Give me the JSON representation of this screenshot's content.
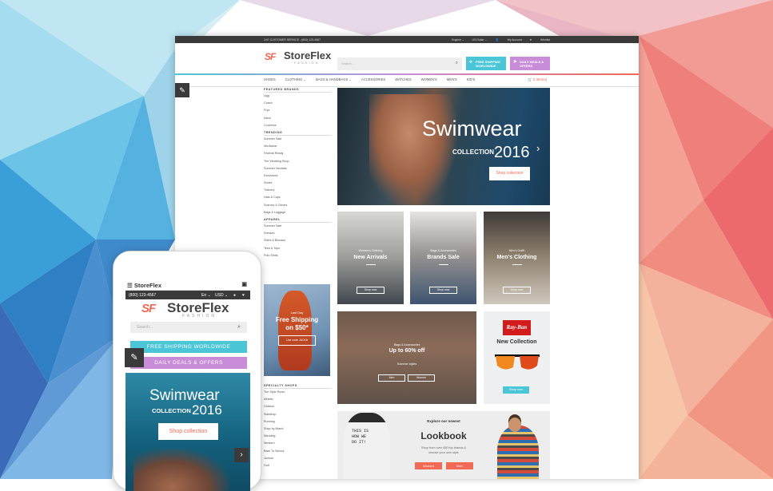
{
  "desktop": {
    "topbar": {
      "service": "24/7 CUSTOMER SERVICE - (800) 123-4567",
      "language": "English ⌄",
      "currency": "US Dollar ⌄",
      "account": "My Account",
      "wishlist": "Wishlist"
    },
    "logo": {
      "mark": "SF",
      "name": "StoreFlex",
      "sub": "FASHION"
    },
    "search": {
      "placeholder": "Search..."
    },
    "promos": {
      "free_shipping": "FREE SHIPPING WORLDWIDE",
      "deals": "DAILY DEALS & OFFERS"
    },
    "nav": [
      "SHOES",
      "CLOTHING ⌄",
      "BAGS & HANDBAGS ⌄",
      "ACCESSORIES",
      "WATCHES",
      "WOMEN'S",
      "MEN'S",
      "KID'S"
    ],
    "cart": "0 item(s)",
    "sidebar": {
      "featured_heading": "FEATURED BRANDS",
      "featured": [
        "Ugg",
        "Coach",
        "Frye",
        "Asics",
        "Converse"
      ],
      "trending_heading": "TRENDING",
      "trending": [
        "Summer Sale",
        "Workwear",
        "Festival Ready",
        "The Wedding Shop",
        "Summer Neutrals",
        "Exclusives",
        "Shoes",
        "Trainers",
        "Hats & Caps",
        "Scarves & Gloves",
        "Bags & Luggage"
      ],
      "apparel_heading": "APPAREL",
      "apparel": [
        "Summer Sale",
        "Dresses",
        "Shirts & Blouses",
        "Tees & Tops",
        "Polo Shirts"
      ],
      "specialty_heading": "SPECIALTY SHOPS",
      "specialty": [
        "The Style Room",
        "Athletic",
        "Outdoor",
        "Sideshop",
        "Running",
        "Shop by Brand",
        "Wedding",
        "Western",
        "Back To School",
        "Juniors",
        "Golf"
      ]
    },
    "side_promo": {
      "small": "Last Day",
      "title1": "Free Shipping",
      "title2": "on $50*",
      "button": "Use code JACK8"
    },
    "hero": {
      "title": "Swimwear",
      "collection": "COLLECTION",
      "year": "2016",
      "button": "Shop collection"
    },
    "tiles": [
      {
        "small": "Women's Clothing",
        "title": "New Arrivals",
        "button": "Shop now"
      },
      {
        "small": "Bags & Accessories",
        "title": "Brands Sale",
        "button": "Shop now"
      },
      {
        "small": "Men's Outfit",
        "title": "Men's Clothing",
        "button": "Shop now"
      }
    ],
    "bags": {
      "small": "Bags & Accessories",
      "title": "Up to 60% off",
      "sub": "Summer styles",
      "btn_men": "Men",
      "btn_women": "Women"
    },
    "sunglasses": {
      "brand": "Ray-Ban",
      "title": "New Collection",
      "button": "Shop now"
    },
    "lookbook": {
      "small": "Explore our newest",
      "title": "Lookbook",
      "desc1": "Shop from over 450 top brands &",
      "desc2": "choose your own style",
      "btn_women": "Women",
      "btn_men": "Men",
      "shirt": [
        "THIS IS",
        "HOW WE",
        "DO IT!"
      ]
    }
  },
  "mobile": {
    "brand": "StoreFlex",
    "phone": "(800) 123-4567",
    "lang": "En ⌄",
    "currency": "USD ⌄",
    "logo": {
      "mark": "SF",
      "name": "StoreFlex",
      "sub": "FASHION"
    },
    "search": {
      "placeholder": "Search..."
    },
    "free_shipping": "FREE SHIPPING WORLDWIDE",
    "deals": "DAILY DEALS & OFFERS",
    "hero": {
      "title": "Swimwear",
      "collection": "COLLECTION",
      "year": "2016",
      "button": "Shop collection"
    }
  },
  "colors": {
    "accent": "#f06a55",
    "teal": "#4bc6d6",
    "purple": "#c88cd8",
    "dark": "#3a3a3a"
  }
}
